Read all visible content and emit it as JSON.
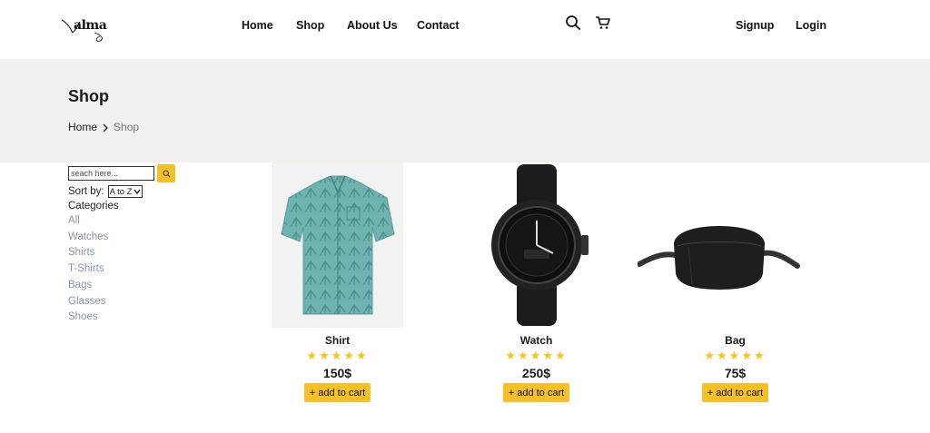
{
  "header": {
    "logo_text": "alma",
    "nav": [
      "Home",
      "Shop",
      "About Us",
      "Contact"
    ],
    "icons": [
      "search-icon",
      "cart-icon"
    ],
    "signup_label": "Signup",
    "login_label": "Login"
  },
  "banner": {
    "title": "Shop",
    "breadcrumb": {
      "home": "Home",
      "current": "Shop"
    }
  },
  "sidebar": {
    "search_placeholder": "seach here...",
    "sort_label": "Sort by:",
    "sort_selected": "A to Z",
    "categories_heading": "Categories",
    "categories": [
      "All",
      "Watches",
      "Shirts",
      "T-Shirts",
      "Bags",
      "Glasses",
      "Shoes"
    ]
  },
  "products": [
    {
      "name": "Shirt",
      "rating": 5,
      "stars": "★★★★★",
      "price": "150$",
      "cart_label": "+ add to cart"
    },
    {
      "name": "Watch",
      "rating": 5,
      "stars": "★★★★★",
      "price": "250$",
      "cart_label": "+ add to cart"
    },
    {
      "name": "Bag",
      "rating": 5,
      "stars": "★★★★★",
      "price": "75$",
      "cart_label": "+ add to cart"
    }
  ],
  "colors": {
    "accent": "#f6c026",
    "banner_bg": "#f1f0ec",
    "star": "#f5c518",
    "category_text": "#8a95a3"
  }
}
